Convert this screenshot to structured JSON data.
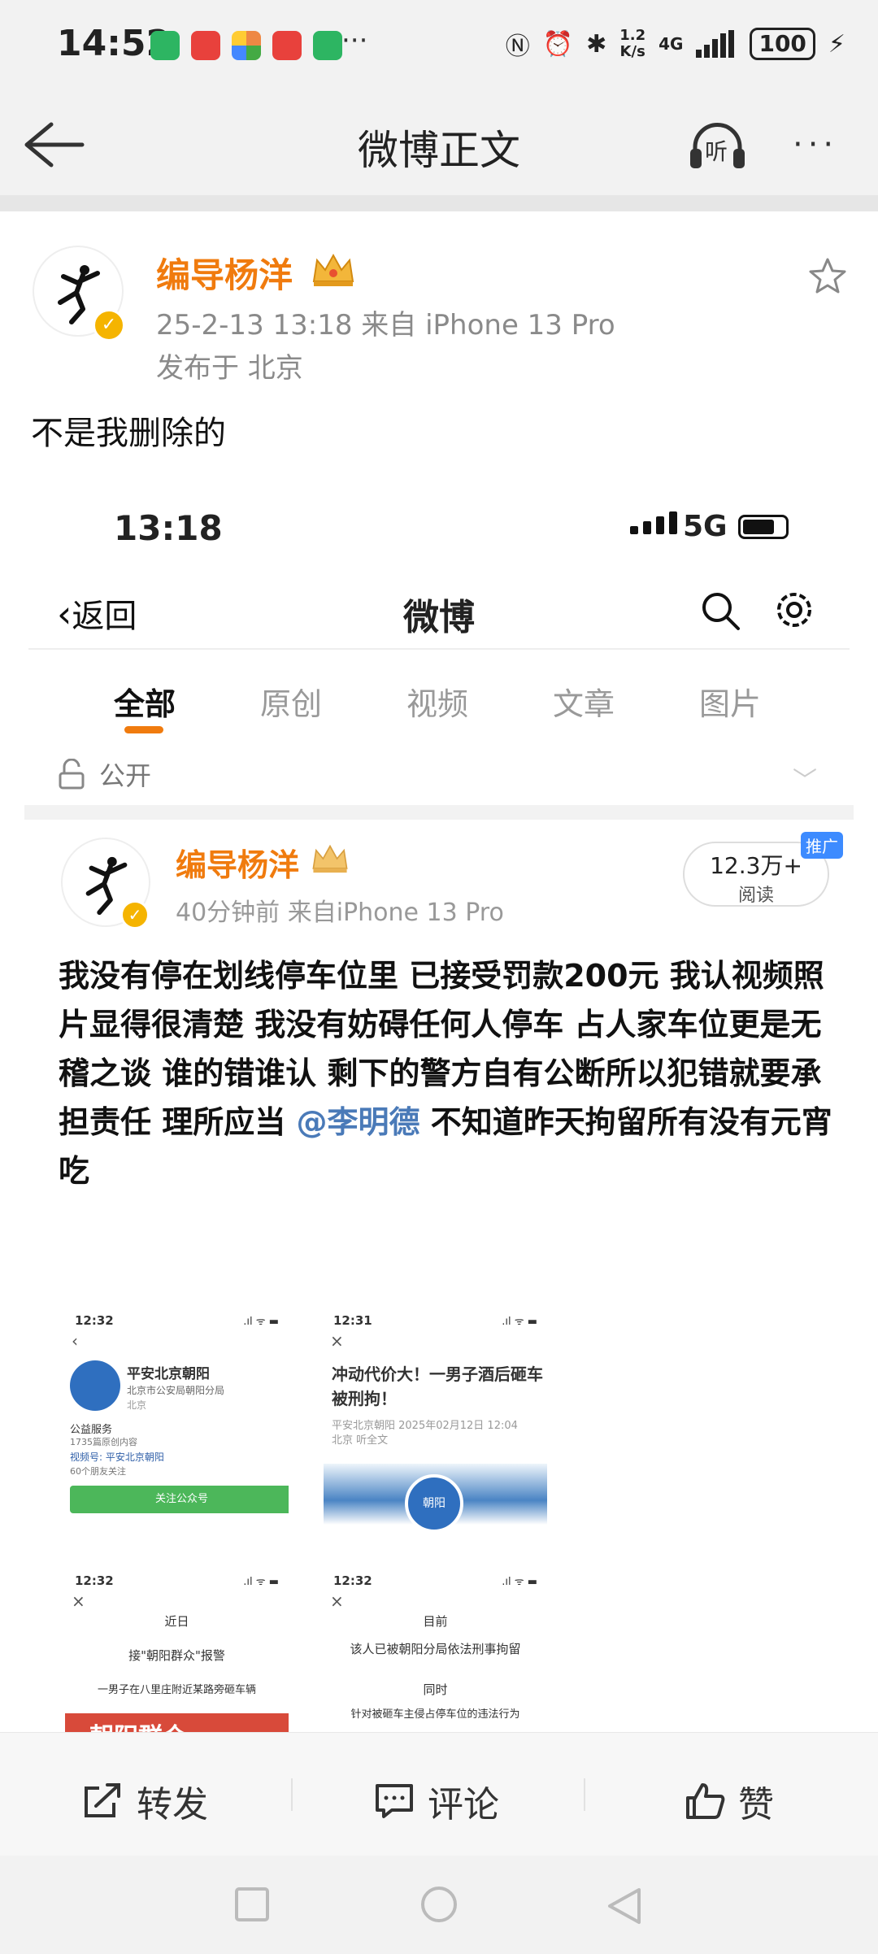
{
  "status_bar": {
    "time": "14:52",
    "speed_value": "1.2",
    "speed_unit": "K/s",
    "network": "4G",
    "battery": "100",
    "more": "···"
  },
  "nav": {
    "title": "微博正文",
    "listen_label": "听",
    "more": "···"
  },
  "post": {
    "username": "编导杨洋",
    "time_source": "25-2-13 13:18   来自 iPhone 13 Pro",
    "location": "发布于 北京",
    "text": "不是我删除的"
  },
  "embedded": {
    "time": "13:18",
    "network": "5G",
    "back_label": "返回",
    "title": "微博",
    "tabs": [
      "全部",
      "原创",
      "视频",
      "文章",
      "图片"
    ],
    "public_label": "公开",
    "username": "编导杨洋",
    "meta": "40分钟前  来自iPhone 13 Pro",
    "reads_count": "12.3万+",
    "reads_label": "阅读",
    "promo_label": "推广",
    "body_before": "我没有停在划线停车位里 已接受罚款200元 我认视频照片显得很清楚 我没有妨碍任何人停车 占人家车位更是无稽之谈 谁的错谁认 剩下的警方自有公断所以犯错就要承担责任 理所应当 ",
    "mention": "@李明德",
    "body_after": " 不知道昨天拘留所有没有元宵吃",
    "thumbs": {
      "t1": {
        "time": "12:32",
        "name": "平安北京朝阳",
        "sub": "北京市公安局朝阳分局",
        "loc": "北京",
        "service": "公益服务",
        "count": "1735篇原创内容",
        "video": "视频号: 平安北京朝阳",
        "friends": "60个朋友关注",
        "follow": "关注公众号"
      },
      "t2": {
        "time": "12:31",
        "headline": "冲动代价大！一男子酒后砸车被刑拘！",
        "source": "平安北京朝阳  2025年02月12日 12:04",
        "source2": "北京   听全文",
        "badge": "朝阳"
      },
      "t3": {
        "time": "12:32",
        "line1": "近日",
        "line2": "接\"朝阳群众\"报警",
        "line3": "一男子在八里庄附近某路旁砸车辆",
        "banner": "朝阳群众"
      },
      "t4": {
        "time": "12:32",
        "line1": "目前",
        "line2": "该人已被朝阳分局依法刑事拘留",
        "line3": "同时",
        "line4": "针对被砸车主侵占停车位的违法行为"
      }
    }
  },
  "actions": {
    "repost": "转发",
    "comment": "评论",
    "like": "赞"
  },
  "colors": {
    "accent_orange": "#f07b0e",
    "mention_blue": "#4a7ab8",
    "verified_gold": "#f5b400"
  }
}
